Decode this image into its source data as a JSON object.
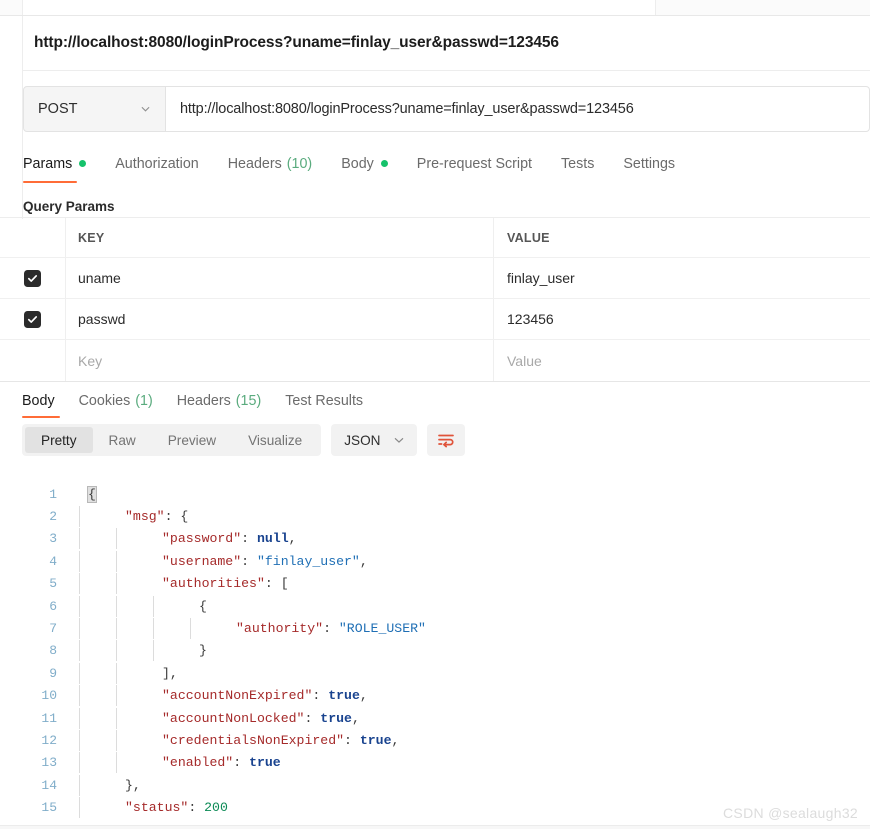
{
  "window": {
    "url_display": "http://localhost:8080/loginProcess?uname=finlay_user&passwd=123456"
  },
  "request": {
    "method": "POST",
    "method_chevron_icon": "chevron-down-icon",
    "url_value": "http://localhost:8080/loginProcess?uname=finlay_user&passwd=123456",
    "tabs": [
      {
        "label": "Params",
        "has_dot": true,
        "count": "",
        "active": true
      },
      {
        "label": "Authorization",
        "has_dot": false,
        "count": "",
        "active": false
      },
      {
        "label": "Headers",
        "has_dot": false,
        "count": "(10)",
        "active": false
      },
      {
        "label": "Body",
        "has_dot": true,
        "count": "",
        "active": false
      },
      {
        "label": "Pre-request Script",
        "has_dot": false,
        "count": "",
        "active": false
      },
      {
        "label": "Tests",
        "has_dot": false,
        "count": "",
        "active": false
      },
      {
        "label": "Settings",
        "has_dot": false,
        "count": "",
        "active": false
      }
    ],
    "section_title": "Query Params",
    "table": {
      "headers": {
        "key": "KEY",
        "value": "VALUE"
      },
      "rows": [
        {
          "checked": true,
          "key": "uname",
          "value": "finlay_user"
        },
        {
          "checked": true,
          "key": "passwd",
          "value": "123456"
        }
      ],
      "placeholder_row": {
        "key": "Key",
        "value": "Value"
      }
    }
  },
  "response": {
    "tabs": [
      {
        "label": "Body",
        "count": "",
        "active": true
      },
      {
        "label": "Cookies",
        "count": "(1)",
        "active": false
      },
      {
        "label": "Headers",
        "count": "(15)",
        "active": false
      },
      {
        "label": "Test Results",
        "count": "",
        "active": false
      }
    ],
    "view_modes": [
      "Pretty",
      "Raw",
      "Preview",
      "Visualize"
    ],
    "active_view_mode": "Pretty",
    "format": "JSON",
    "format_chevron_icon": "chevron-down-icon",
    "wrap_icon": "word-wrap-icon",
    "body_lines": [
      {
        "n": "1",
        "indent": 0,
        "tokens": [
          {
            "t": "{",
            "c": "p",
            "hl": true
          }
        ]
      },
      {
        "n": "2",
        "indent": 1,
        "tokens": [
          {
            "t": "\"msg\"",
            "c": "k"
          },
          {
            "t": ": ",
            "c": "p"
          },
          {
            "t": "{",
            "c": "p"
          }
        ]
      },
      {
        "n": "3",
        "indent": 2,
        "tokens": [
          {
            "t": "\"password\"",
            "c": "k"
          },
          {
            "t": ": ",
            "c": "p"
          },
          {
            "t": "null",
            "c": "b"
          },
          {
            "t": ",",
            "c": "p"
          }
        ]
      },
      {
        "n": "4",
        "indent": 2,
        "tokens": [
          {
            "t": "\"username\"",
            "c": "k"
          },
          {
            "t": ": ",
            "c": "p"
          },
          {
            "t": "\"finlay_user\"",
            "c": "s"
          },
          {
            "t": ",",
            "c": "p"
          }
        ]
      },
      {
        "n": "5",
        "indent": 2,
        "tokens": [
          {
            "t": "\"authorities\"",
            "c": "k"
          },
          {
            "t": ": ",
            "c": "p"
          },
          {
            "t": "[",
            "c": "p"
          }
        ]
      },
      {
        "n": "6",
        "indent": 3,
        "tokens": [
          {
            "t": "{",
            "c": "p"
          }
        ]
      },
      {
        "n": "7",
        "indent": 4,
        "tokens": [
          {
            "t": "\"authority\"",
            "c": "k"
          },
          {
            "t": ": ",
            "c": "p"
          },
          {
            "t": "\"ROLE_USER\"",
            "c": "s"
          }
        ]
      },
      {
        "n": "8",
        "indent": 3,
        "tokens": [
          {
            "t": "}",
            "c": "p"
          }
        ]
      },
      {
        "n": "9",
        "indent": 2,
        "tokens": [
          {
            "t": "],",
            "c": "p"
          }
        ]
      },
      {
        "n": "10",
        "indent": 2,
        "tokens": [
          {
            "t": "\"accountNonExpired\"",
            "c": "k"
          },
          {
            "t": ": ",
            "c": "p"
          },
          {
            "t": "true",
            "c": "b"
          },
          {
            "t": ",",
            "c": "p"
          }
        ]
      },
      {
        "n": "11",
        "indent": 2,
        "tokens": [
          {
            "t": "\"accountNonLocked\"",
            "c": "k"
          },
          {
            "t": ": ",
            "c": "p"
          },
          {
            "t": "true",
            "c": "b"
          },
          {
            "t": ",",
            "c": "p"
          }
        ]
      },
      {
        "n": "12",
        "indent": 2,
        "tokens": [
          {
            "t": "\"credentialsNonExpired\"",
            "c": "k"
          },
          {
            "t": ": ",
            "c": "p"
          },
          {
            "t": "true",
            "c": "b"
          },
          {
            "t": ",",
            "c": "p"
          }
        ]
      },
      {
        "n": "13",
        "indent": 2,
        "tokens": [
          {
            "t": "\"enabled\"",
            "c": "k"
          },
          {
            "t": ": ",
            "c": "p"
          },
          {
            "t": "true",
            "c": "b"
          }
        ]
      },
      {
        "n": "14",
        "indent": 1,
        "tokens": [
          {
            "t": "},",
            "c": "p"
          }
        ]
      },
      {
        "n": "15",
        "indent": 1,
        "tokens": [
          {
            "t": "\"status\"",
            "c": "k"
          },
          {
            "t": ": ",
            "c": "p"
          },
          {
            "t": "200",
            "c": "n"
          }
        ]
      }
    ]
  },
  "watermark": "CSDN @sealaugh32",
  "colors": {
    "accent_orange": "#ff6c37",
    "status_green": "#15c26b",
    "count_green": "#5aab7e",
    "json_key": "#a52a2a",
    "json_string": "#1f6fb5",
    "json_number": "#0b8a55",
    "json_bool": "#19438f"
  }
}
